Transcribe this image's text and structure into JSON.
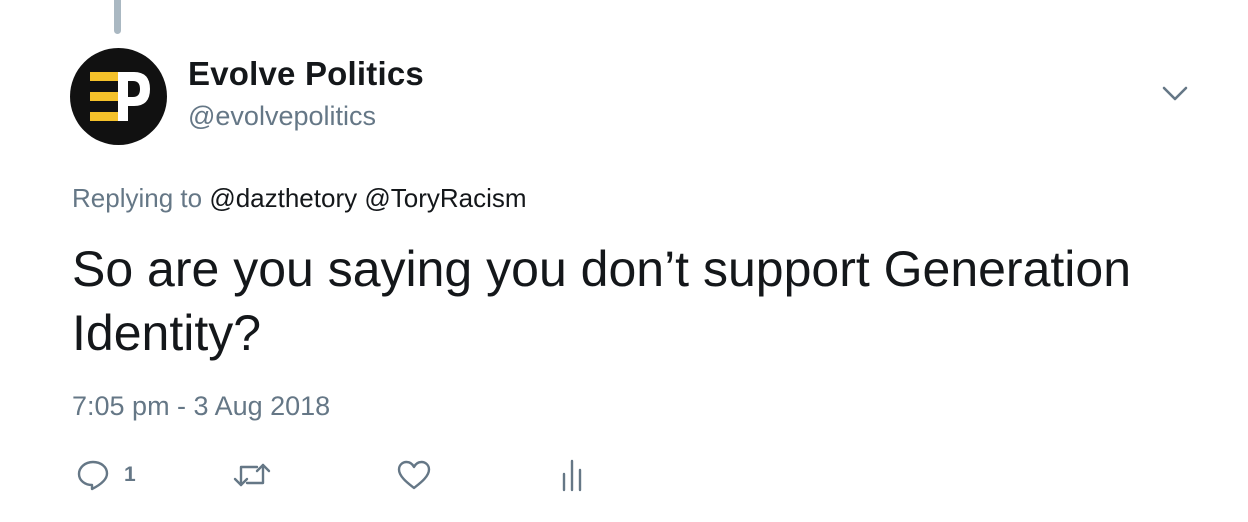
{
  "tweet": {
    "author": {
      "display_name": "Evolve Politics",
      "handle": "@evolvepolitics",
      "avatar_text": "EP"
    },
    "replying_to": {
      "prefix": "Replying to",
      "mentions": [
        "@dazthetory",
        "@ToryRacism"
      ]
    },
    "text": "So are you saying you don’t support Generation Identity?",
    "timestamp": "7:05 pm - 3 Aug 2018",
    "actions": {
      "reply_count": "1"
    }
  },
  "icons": {
    "more": "chevron-down-icon",
    "reply": "reply-icon",
    "retweet": "retweet-icon",
    "like": "heart-icon",
    "analytics": "analytics-icon"
  },
  "colors": {
    "text_primary": "#14171a",
    "text_secondary": "#657786",
    "icon_gray": "#657786",
    "avatar_background": "#111111",
    "logo_yellow": "#f4c12a"
  }
}
